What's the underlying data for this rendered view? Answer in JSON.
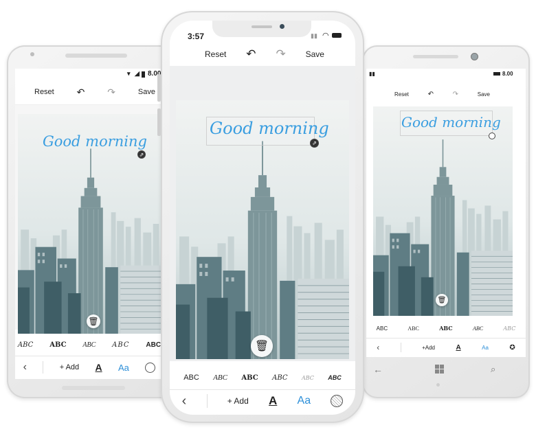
{
  "left_phone": {
    "status": {
      "time": "8.00"
    },
    "toolbar": {
      "reset": "Reset",
      "save": "Save"
    },
    "overlay_text": "Good morning",
    "fonts": [
      "ABC",
      "ABC",
      "ABC",
      "ABC",
      "ABC"
    ],
    "bottom": {
      "add": "+ Add",
      "color": "A",
      "font": "Aa"
    }
  },
  "center_phone": {
    "status": {
      "time": "3:57"
    },
    "toolbar": {
      "reset": "Reset",
      "save": "Save"
    },
    "overlay_text": "Good morning",
    "fonts": [
      "ABC",
      "ABC",
      "ABC",
      "ABC",
      "ABC",
      "ABC"
    ],
    "bottom": {
      "add": "+ Add",
      "color": "A",
      "font": "Aa"
    }
  },
  "right_phone": {
    "status": {
      "time": "8.00"
    },
    "toolbar": {
      "reset": "Reset",
      "save": "Save"
    },
    "overlay_text": "Good morning",
    "fonts": [
      "ABC",
      "ABC",
      "ABC",
      "ABC",
      "ABC"
    ],
    "bottom": {
      "add": "+Add",
      "color": "A",
      "font": "Aa"
    }
  },
  "colors": {
    "accent": "#2d8fd8",
    "sky": "#e9eeee",
    "building": "#6f8c92"
  }
}
